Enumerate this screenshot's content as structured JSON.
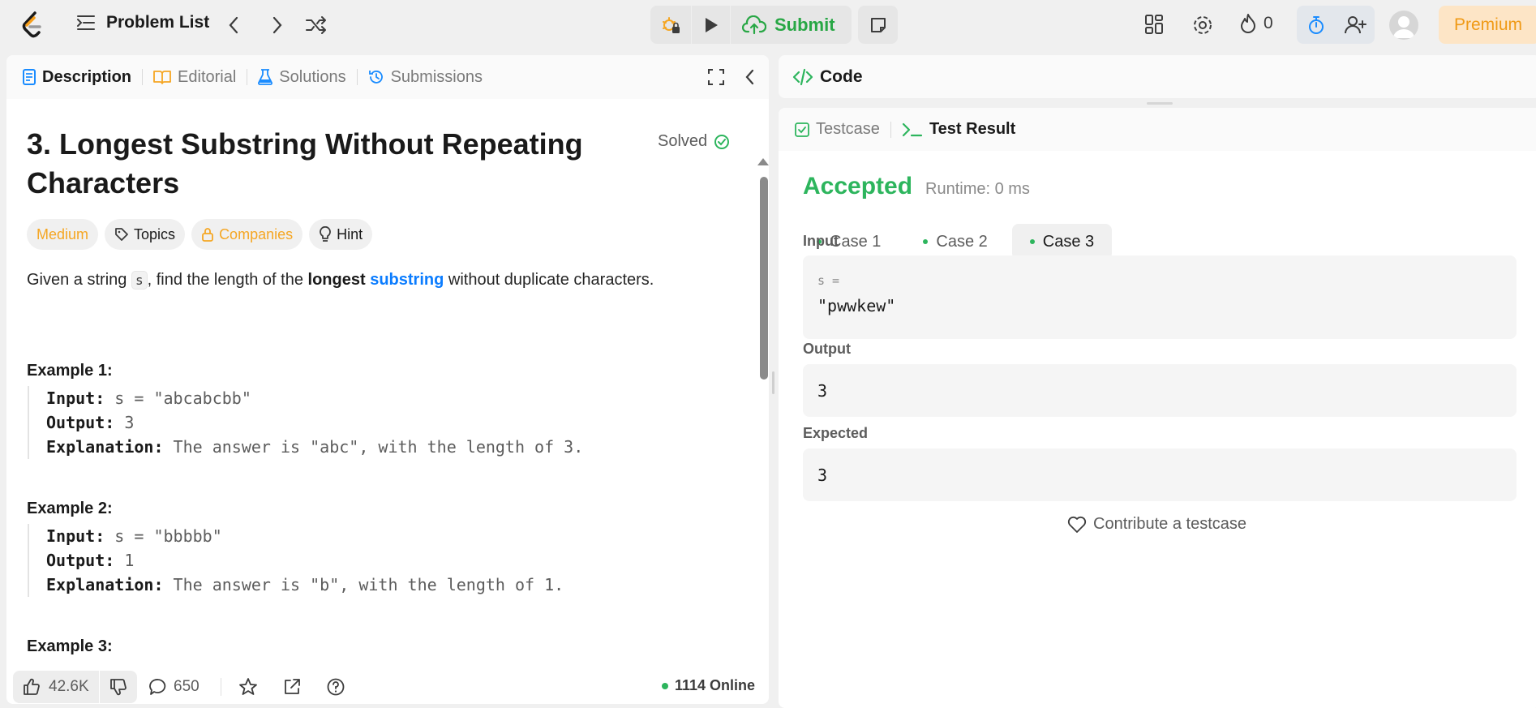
{
  "header": {
    "problem_list": "Problem List",
    "submit_label": "Submit",
    "streak_count": "0",
    "premium_label": "Premium"
  },
  "left_tabs": [
    {
      "label": "Description"
    },
    {
      "label": "Editorial"
    },
    {
      "label": "Solutions"
    },
    {
      "label": "Submissions"
    }
  ],
  "problem": {
    "title": "3. Longest Substring Without Repeating Characters",
    "solved_label": "Solved",
    "difficulty": "Medium",
    "tags": {
      "topics": "Topics",
      "companies": "Companies",
      "hint": "Hint"
    },
    "description": {
      "part1": "Given a string ",
      "code": "s",
      "part2": ", find the length of the ",
      "bold": "longest",
      "space": " ",
      "link": "substring",
      "part3": " without duplicate characters."
    },
    "examples": [
      {
        "heading": "Example 1:",
        "input_label": "Input:",
        "input": " s = \"abcabcbb\"",
        "output_label": "Output:",
        "output": " 3",
        "explanation_label": "Explanation:",
        "explanation": " The answer is \"abc\", with the length of 3."
      },
      {
        "heading": "Example 2:",
        "input_label": "Input:",
        "input": " s = \"bbbbb\"",
        "output_label": "Output:",
        "output": " 1",
        "explanation_label": "Explanation:",
        "explanation": " The answer is \"b\", with the length of 1."
      },
      {
        "heading": "Example 3:"
      }
    ]
  },
  "footer": {
    "likes": "42.6K",
    "comments": "650",
    "online": "1114 Online"
  },
  "code_panel": {
    "title": "Code"
  },
  "result_panel": {
    "tabs": [
      "Testcase",
      "Test Result"
    ],
    "status": "Accepted",
    "runtime": "Runtime: 0 ms",
    "cases": [
      "Case 1",
      "Case 2",
      "Case 3"
    ],
    "active_case": "Case 3",
    "input_label": "Input",
    "input_var": "s =",
    "input_value": "\"pwwkew\"",
    "output_label": "Output",
    "output_value": "3",
    "expected_label": "Expected",
    "expected_value": "3",
    "contribute": "Contribute a testcase"
  },
  "colors": {
    "accent_green": "#2db55d",
    "accent_orange": "#f5a623",
    "link_blue": "#0a7cff",
    "premium_bg": "#fde5c6"
  },
  "icons": [
    "leetcode-logo",
    "list-icon",
    "chevron-left-icon",
    "chevron-right-icon",
    "shuffle-icon",
    "debug-icon",
    "play-icon",
    "cloud-upload-icon",
    "note-icon",
    "layout-icon",
    "gear-icon",
    "fire-icon",
    "timer-icon",
    "add-user-icon",
    "avatar",
    "description-icon",
    "book-icon",
    "flask-icon",
    "history-icon",
    "expand-icon",
    "collapse-icon",
    "check-circle-icon",
    "tag-icon",
    "lock-icon",
    "bulb-icon",
    "thumb-up-icon",
    "thumb-down-icon",
    "comment-icon",
    "star-icon",
    "share-icon",
    "help-icon",
    "code-icon",
    "checkbox-icon",
    "terminal-icon",
    "heart-icon"
  ]
}
